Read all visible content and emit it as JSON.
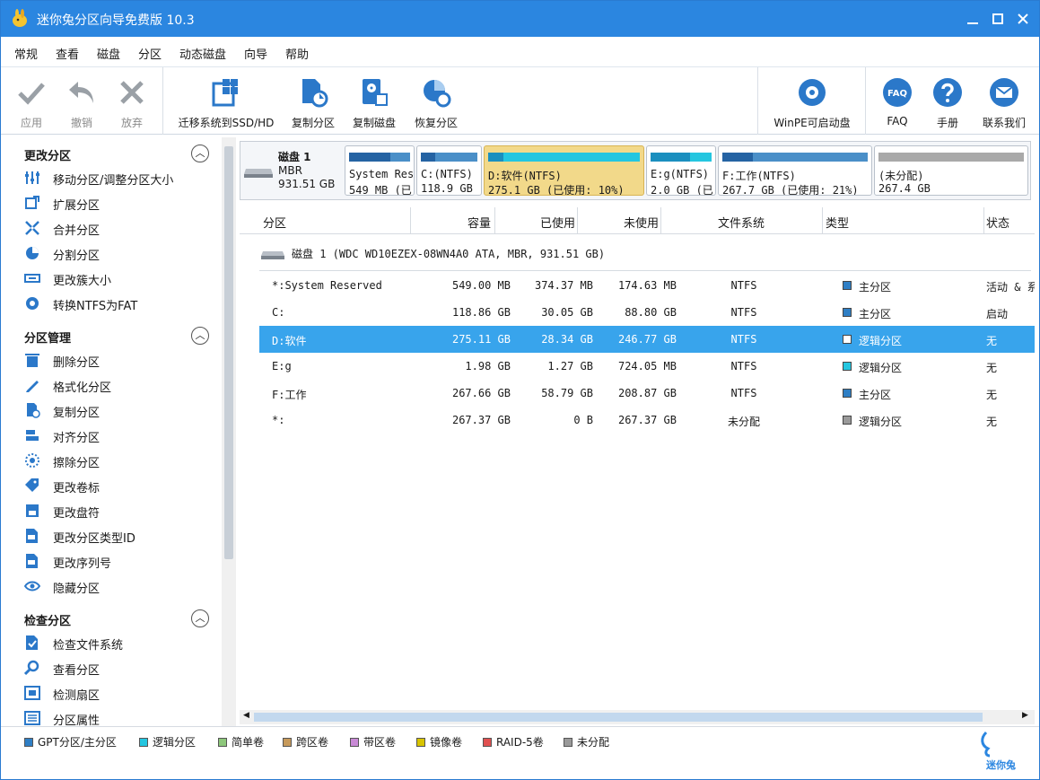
{
  "window": {
    "title": "迷你兔分区向导免费版 10.3"
  },
  "menu": [
    "常规",
    "查看",
    "磁盘",
    "分区",
    "动态磁盘",
    "向导",
    "帮助"
  ],
  "toolbar": {
    "apply": "应用",
    "undo": "撤销",
    "discard": "放弃",
    "migrate": "迁移系统到SSD/HD",
    "copy_partition": "复制分区",
    "copy_disk": "复制磁盘",
    "recover": "恢复分区",
    "winpe": "WinPE可启动盘",
    "faq_icon_text": "FAQ",
    "faq": "FAQ",
    "manual": "手册",
    "contact": "联系我们"
  },
  "sidebar": {
    "sections": [
      {
        "title": "更改分区",
        "items": [
          "移动分区/调整分区大小",
          "扩展分区",
          "合并分区",
          "分割分区",
          "更改簇大小",
          "转换NTFS为FAT"
        ]
      },
      {
        "title": "分区管理",
        "items": [
          "删除分区",
          "格式化分区",
          "复制分区",
          "对齐分区",
          "擦除分区",
          "更改卷标",
          "更改盘符",
          "更改分区类型ID",
          "更改序列号",
          "隐藏分区"
        ]
      },
      {
        "title": "检查分区",
        "items": [
          "检查文件系统",
          "查看分区",
          "检测扇区",
          "分区属性"
        ]
      }
    ]
  },
  "diskmap": {
    "name": "磁盘 1",
    "type": "MBR",
    "size": "931.51 GB",
    "segments": [
      {
        "line1": "System Res",
        "line2": "549 MB (已",
        "used": 0.68,
        "bar_color": "#4a8fc8",
        "used_color": "#2563a3",
        "selected": false
      },
      {
        "line1": "C:(NTFS)",
        "line2": "118.9 GB",
        "used": 0.25,
        "bar_color": "#4a8fc8",
        "used_color": "#2563a3",
        "selected": false
      },
      {
        "line1": "D:软件(NTFS)",
        "line2": "275.1 GB (已使用: 10%)",
        "used": 0.1,
        "bar_color": "#24c6e0",
        "used_color": "#1a8fbf",
        "selected": true
      },
      {
        "line1": "E:g(NTFS)",
        "line2": "2.0 GB (已",
        "used": 0.64,
        "bar_color": "#24c6e0",
        "used_color": "#1a8fbf",
        "selected": false
      },
      {
        "line1": "F:工作(NTFS)",
        "line2": "267.7 GB (已使用: 21%)",
        "used": 0.21,
        "bar_color": "#4a8fc8",
        "used_color": "#2563a3",
        "selected": false
      },
      {
        "line1": "(未分配)",
        "line2": "267.4 GB",
        "used": 0,
        "bar_color": "#a9a9a9",
        "used_color": "#a9a9a9",
        "selected": false
      }
    ]
  },
  "table": {
    "headers": [
      "分区",
      "容量",
      "已使用",
      "未使用",
      "文件系统",
      "类型",
      "状态"
    ],
    "disk_row": "磁盘 1 (WDC WD10EZEX-08WN4A0 ATA, MBR, 931.51 GB)",
    "rows": [
      {
        "partition": "*:System Reserved",
        "capacity": "549.00 MB",
        "used": "374.37 MB",
        "unused": "174.63 MB",
        "fs": "NTFS",
        "type": "主分区",
        "type_color": "#2f7fc5",
        "status": "活动 & 系",
        "selected": false
      },
      {
        "partition": "C:",
        "capacity": "118.86 GB",
        "used": "30.05 GB",
        "unused": "88.80 GB",
        "fs": "NTFS",
        "type": "主分区",
        "type_color": "#2f7fc5",
        "status": "启动",
        "selected": false
      },
      {
        "partition": "D:软件",
        "capacity": "275.11 GB",
        "used": "28.34 GB",
        "unused": "246.77 GB",
        "fs": "NTFS",
        "type": "逻辑分区",
        "type_color": "#38a4ec",
        "status": "无",
        "selected": true
      },
      {
        "partition": "E:g",
        "capacity": "1.98 GB",
        "used": "1.27 GB",
        "unused": "724.05 MB",
        "fs": "NTFS",
        "type": "逻辑分区",
        "type_color": "#24c6e0",
        "status": "无",
        "selected": false
      },
      {
        "partition": "F:工作",
        "capacity": "267.66 GB",
        "used": "58.79 GB",
        "unused": "208.87 GB",
        "fs": "NTFS",
        "type": "主分区",
        "type_color": "#2f7fc5",
        "status": "无",
        "selected": false
      },
      {
        "partition": "*:",
        "capacity": "267.37 GB",
        "used": "0 B",
        "unused": "267.37 GB",
        "fs": "未分配",
        "type": "逻辑分区",
        "type_color": "#9a9a9a",
        "status": "无",
        "selected": false
      }
    ]
  },
  "legend": [
    {
      "label": "GPT分区/主分区",
      "color": "#2f7fc5"
    },
    {
      "label": "逻辑分区",
      "color": "#24c6e0"
    },
    {
      "label": "简单卷",
      "color": "#8dc77b"
    },
    {
      "label": "跨区卷",
      "color": "#c79a5b"
    },
    {
      "label": "带区卷",
      "color": "#c98ad6"
    },
    {
      "label": "镜像卷",
      "color": "#d8c400"
    },
    {
      "label": "RAID-5卷",
      "color": "#e05050"
    },
    {
      "label": "未分配",
      "color": "#9a9a9a"
    }
  ],
  "brand": "迷你兔"
}
